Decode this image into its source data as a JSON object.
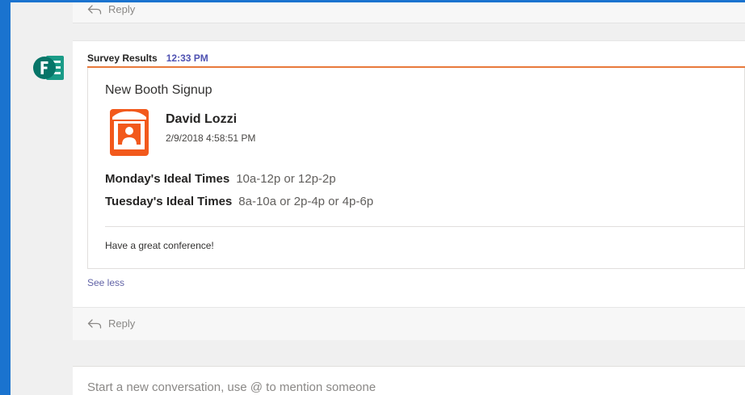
{
  "previous_thread": {
    "reply_label": "Reply",
    "reply_icon": "reply-arrow-icon"
  },
  "message": {
    "avatar_icon": "microsoft-forms-icon",
    "avatar_letter": "F",
    "sender": "Survey Results",
    "time": "12:33 PM",
    "accent_color": "#e8793b",
    "time_color": "#4f52b2"
  },
  "card": {
    "title": "New Booth Signup",
    "icon": "booth-icon",
    "icon_color": "#f2591c",
    "person_name": "David Lozzi",
    "person_date": "2/9/2018 4:58:51 PM",
    "facts": [
      {
        "label": "Monday's Ideal Times",
        "value": "10a-12p or 12p-2p"
      },
      {
        "label": "Tuesday's Ideal Times",
        "value": "8a-10a or 2p-4p or 4p-6p"
      }
    ],
    "footer": "Have a great conference!"
  },
  "see_less_label": "See less",
  "thread_reply": {
    "reply_label": "Reply",
    "reply_icon": "reply-arrow-icon"
  },
  "compose": {
    "placeholder": "Start a new conversation, use @ to mention someone"
  },
  "colors": {
    "frame": "#1a73cf",
    "background": "#f0f0f0",
    "forms_green": "#077568",
    "link": "#6264a7"
  }
}
